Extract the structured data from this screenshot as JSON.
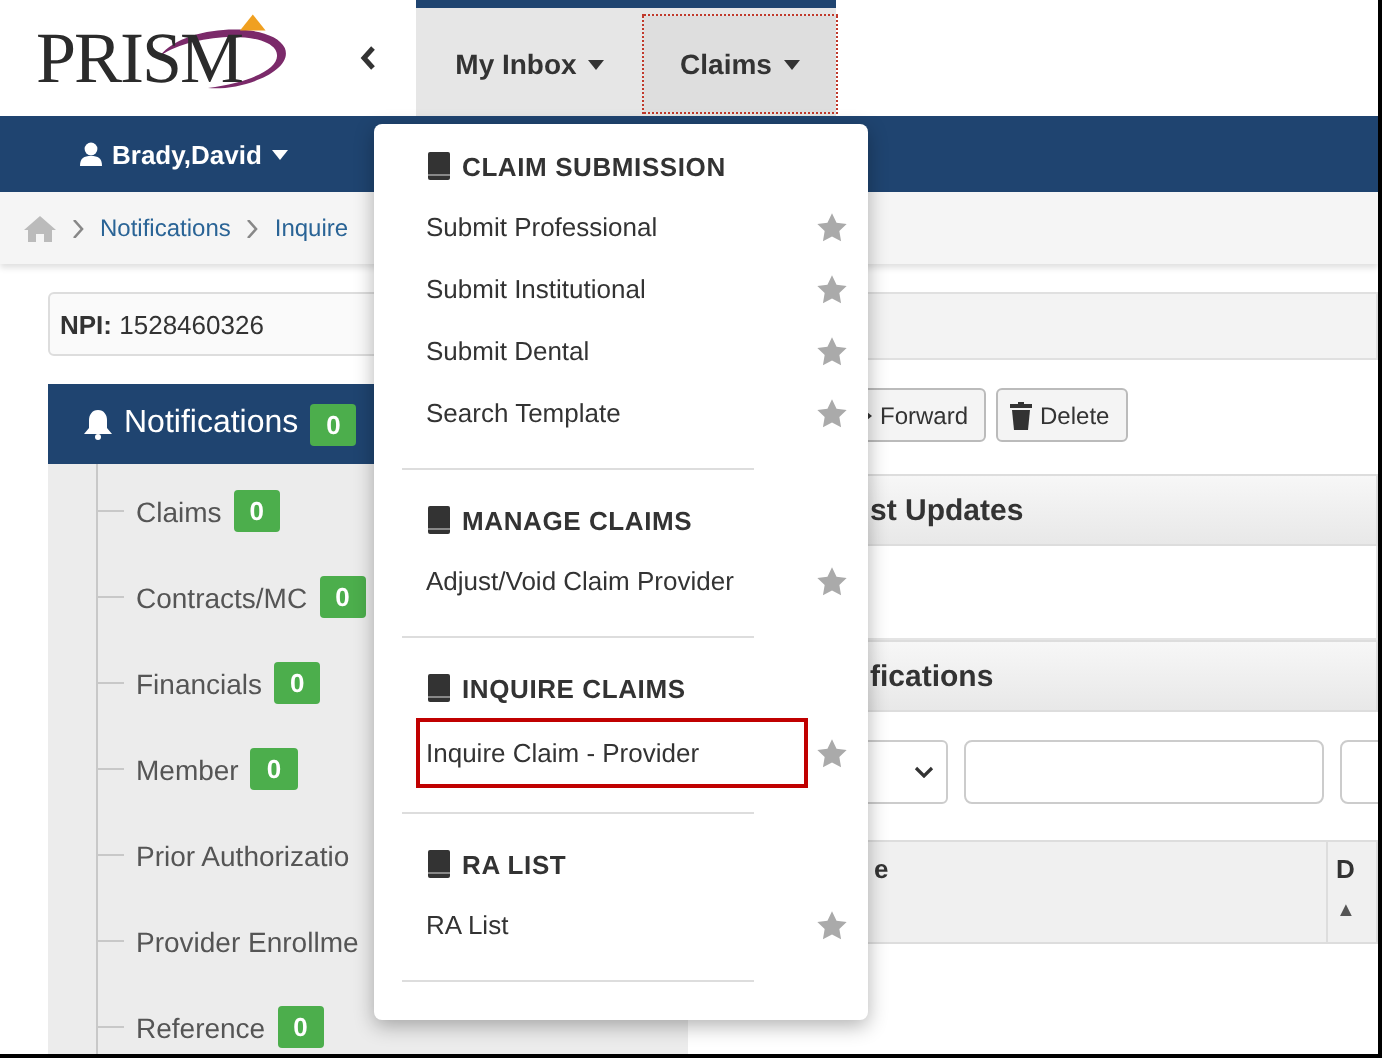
{
  "logo": {
    "text": "PRISM"
  },
  "nav": {
    "tabs": [
      {
        "label": "My Inbox",
        "selected": false
      },
      {
        "label": "Claims",
        "selected": true
      }
    ]
  },
  "user": {
    "name": "Brady,David"
  },
  "breadcrumb": [
    "Notifications",
    "Inquire"
  ],
  "npi": {
    "label": "NPI:",
    "value": "1528460326"
  },
  "notifications": {
    "label": "Notifications",
    "count": "0",
    "items": [
      {
        "label": "Claims",
        "count": "0"
      },
      {
        "label": "Contracts/MC",
        "count": "0"
      },
      {
        "label": "Financials",
        "count": "0"
      },
      {
        "label": "Member",
        "count": "0"
      },
      {
        "label": "Prior Authorizatio"
      },
      {
        "label": "Provider Enrollme"
      },
      {
        "label": "Reference",
        "count": "0"
      }
    ]
  },
  "toolbar": {
    "buttons": [
      {
        "kind": "forward",
        "label": "Forward"
      },
      {
        "kind": "delete",
        "label": "Delete"
      }
    ]
  },
  "panels": [
    {
      "title": "st Updates"
    },
    {
      "title": "fications"
    }
  ],
  "table": {
    "columns": [
      {
        "label": "e"
      },
      {
        "label": "D",
        "sort_mark": "▲"
      }
    ]
  },
  "menu": {
    "sections": [
      {
        "title": "CLAIM SUBMISSION",
        "items": [
          {
            "label": "Submit Professional",
            "highlighted": false
          },
          {
            "label": "Submit Institutional",
            "highlighted": false
          },
          {
            "label": "Submit Dental",
            "highlighted": false
          },
          {
            "label": "Search Template",
            "highlighted": false
          }
        ]
      },
      {
        "title": "MANAGE CLAIMS",
        "items": [
          {
            "label": "Adjust/Void Claim Provider",
            "highlighted": false
          }
        ]
      },
      {
        "title": "INQUIRE CLAIMS",
        "items": [
          {
            "label": "Inquire Claim - Provider",
            "highlighted": true
          }
        ]
      },
      {
        "title": "RA LIST",
        "items": [
          {
            "label": "RA List",
            "highlighted": false
          }
        ]
      }
    ]
  }
}
